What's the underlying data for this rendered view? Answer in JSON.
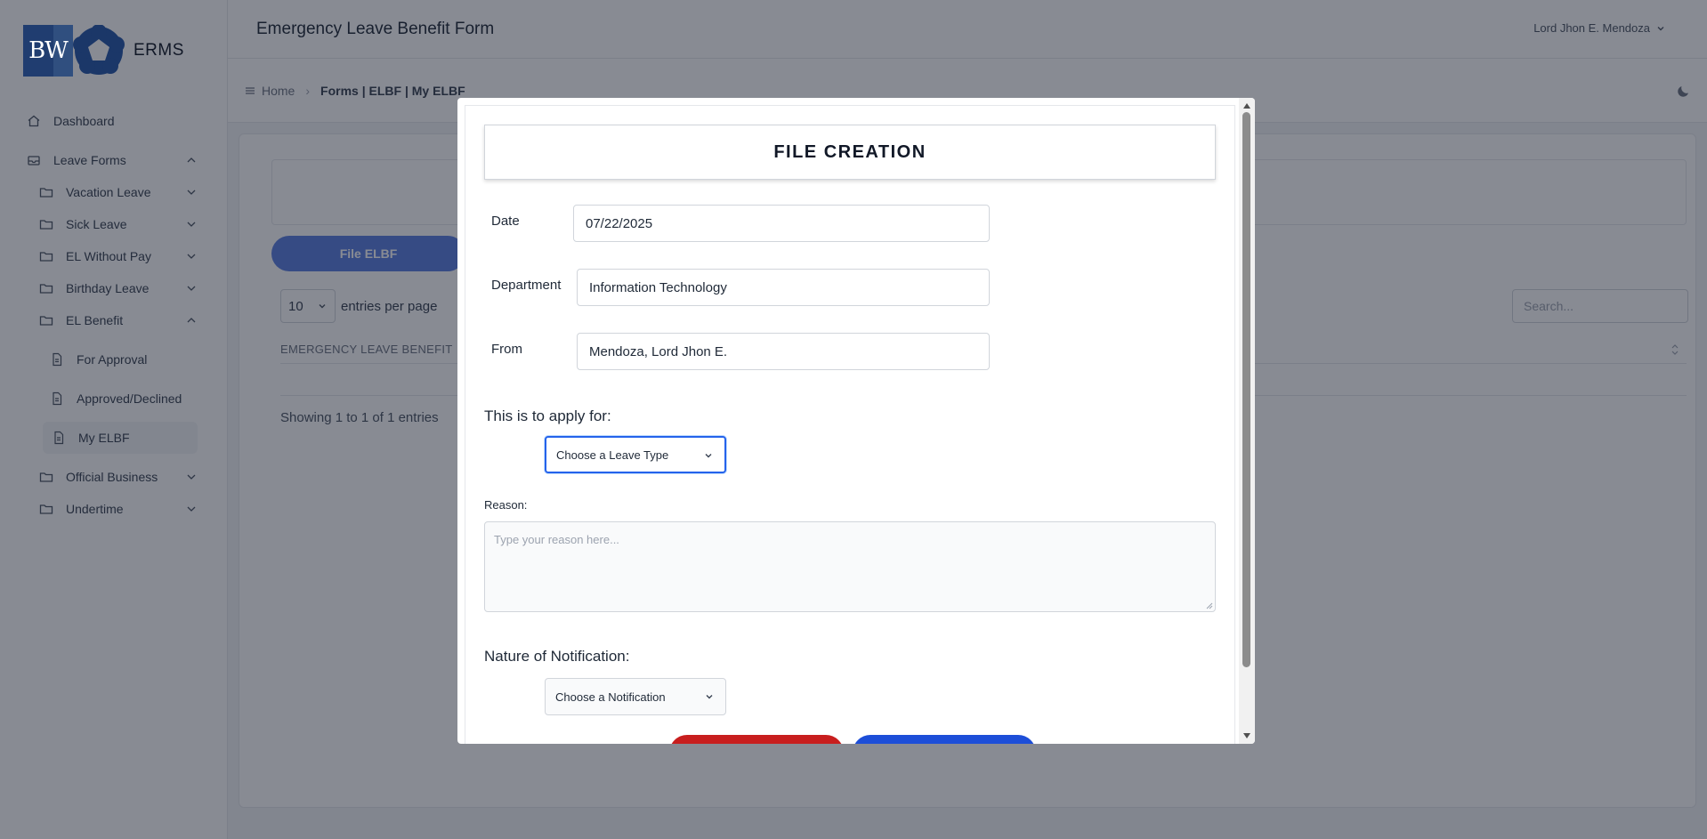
{
  "app": {
    "logo_text": "ERMS",
    "logo_letters": "BW"
  },
  "sidebar": {
    "dashboard": "Dashboard",
    "leave_forms": "Leave Forms",
    "vacation_leave": "Vacation Leave",
    "sick_leave": "Sick Leave",
    "el_without_pay": "EL Without Pay",
    "birthday_leave": "Birthday Leave",
    "el_benefit": "EL Benefit",
    "for_approval": "For Approval",
    "approved_declined": "Approved/Declined",
    "my_elbf": "My ELBF",
    "official_business": "Official Business",
    "undertime": "Undertime"
  },
  "header": {
    "title": "Emergency Leave Benefit Form",
    "user": "Lord Jhon E. Mendoza"
  },
  "breadcrumb": {
    "home": "Home",
    "current": "Forms | ELBF | My ELBF"
  },
  "list": {
    "file_button": "File ELBF",
    "per_page_value": "10",
    "per_page_label": "entries per page",
    "search_placeholder": "Search...",
    "column": "EMERGENCY LEAVE BENEFIT",
    "showing": "Showing 1 to 1 of 1 entries"
  },
  "modal": {
    "title": "FILE CREATION",
    "date_label": "Date",
    "date_value": "07/22/2025",
    "department_label": "Department",
    "department_value": "Information Technology",
    "from_label": "From",
    "from_value": "Mendoza, Lord Jhon E.",
    "apply_for_label": "This is to apply for:",
    "leave_type_placeholder": "Choose a Leave Type",
    "reason_label": "Reason:",
    "reason_placeholder": "Type your reason here...",
    "notification_label": "Nature of Notification:",
    "notification_placeholder": "Choose a Notification"
  },
  "colors": {
    "primary": "#5b7fe0",
    "danger": "#c81e1e",
    "accent": "#1d4ed8",
    "logo_blue": "#2f63b8"
  }
}
